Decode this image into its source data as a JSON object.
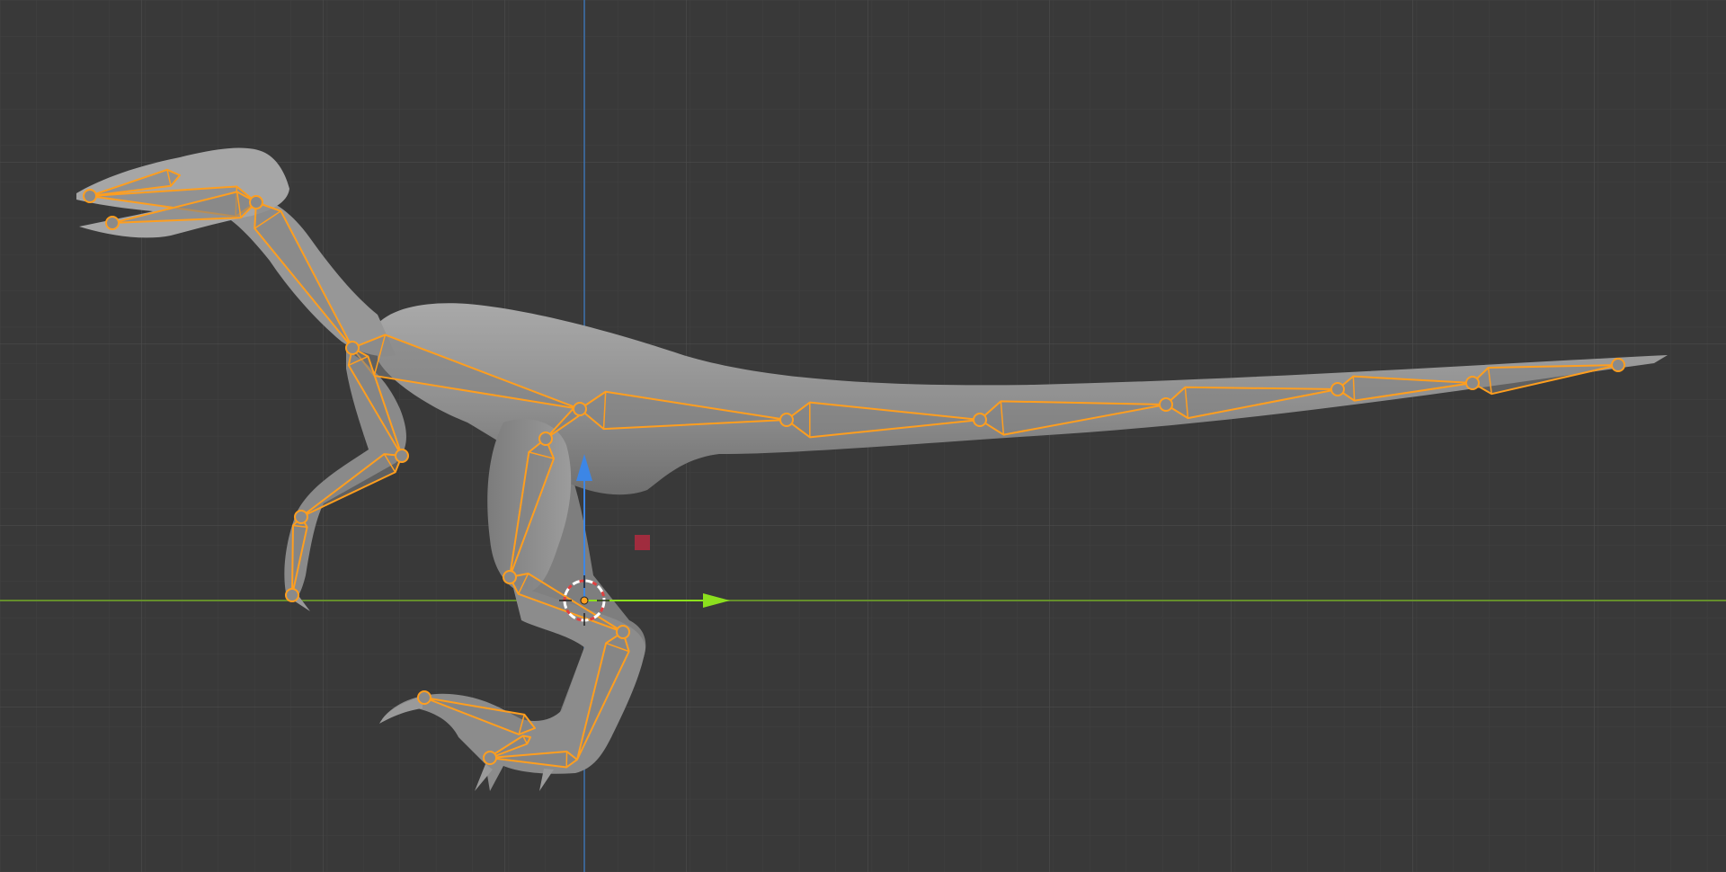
{
  "viewport": {
    "view": "right-orthographic",
    "grid": true,
    "background_color": "#393939",
    "minor_grid_color": "#414141",
    "major_grid_color": "#4b4b4b",
    "axis_x_color": "#6a9a2a",
    "axis_z_color": "#3d6fa8"
  },
  "scene": {
    "mesh_object": "velociraptor",
    "mesh_color": "#8d8d8d",
    "armature_color": "#ff9e1e",
    "armature_selected": true,
    "bone_count": 24,
    "icons": {
      "cursor": "3d-cursor-icon",
      "gizmo_up": "z-axis-arrow-icon",
      "gizmo_forward": "y-axis-arrow-icon",
      "light": "light-icon"
    },
    "gizmo_up_color": "#3c86e6",
    "gizmo_forward_color": "#8ce01e",
    "light_color": "#a02c3e"
  }
}
